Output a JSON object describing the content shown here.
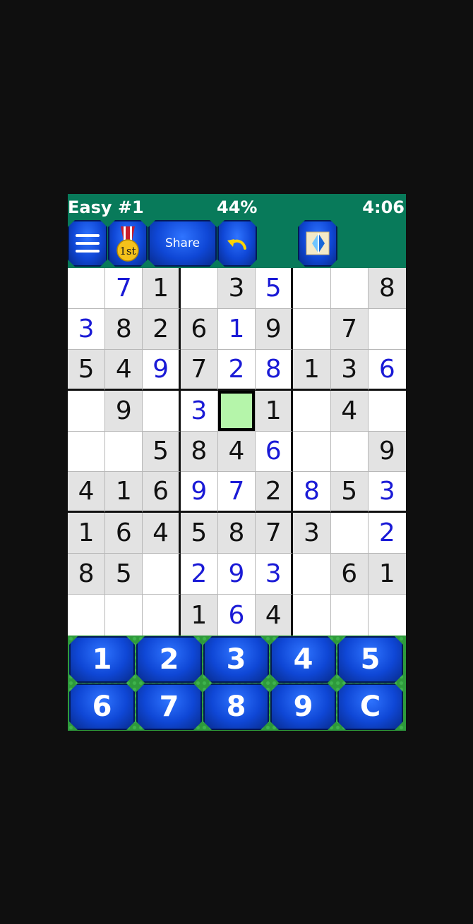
{
  "header": {
    "title": "Easy #1",
    "progress": "44%",
    "timer": "4:06"
  },
  "toolbar": {
    "menu_icon": "hamburger-menu-icon",
    "medal_icon": "first-place-medal-icon",
    "medal_label": "1st",
    "share_label": "Share",
    "undo_icon": "undo-arrow-icon",
    "hint_icon": "hint-panel-icon"
  },
  "board": {
    "selected": [
      3,
      4
    ],
    "rows": [
      [
        "",
        "7",
        "1",
        "",
        "3",
        "5",
        "",
        "",
        "8"
      ],
      [
        "3",
        "8",
        "2",
        "6",
        "1",
        "9",
        "",
        "7",
        ""
      ],
      [
        "5",
        "4",
        "9",
        "7",
        "2",
        "8",
        "1",
        "3",
        "6"
      ],
      [
        "",
        "9",
        "",
        "3",
        "",
        "1",
        "",
        "4",
        ""
      ],
      [
        "",
        "",
        "5",
        "8",
        "4",
        "6",
        "",
        "",
        "9"
      ],
      [
        "4",
        "1",
        "6",
        "9",
        "7",
        "2",
        "8",
        "5",
        "3"
      ],
      [
        "1",
        "6",
        "4",
        "5",
        "8",
        "7",
        "3",
        "",
        "2"
      ],
      [
        "8",
        "5",
        "",
        "2",
        "9",
        "3",
        "",
        "6",
        "1"
      ],
      [
        "",
        "",
        "",
        "1",
        "6",
        "4",
        "",
        "",
        ""
      ]
    ],
    "givens": [
      [
        0,
        0,
        1,
        0,
        1,
        0,
        0,
        0,
        1
      ],
      [
        0,
        1,
        1,
        1,
        0,
        1,
        0,
        1,
        0
      ],
      [
        1,
        1,
        0,
        1,
        0,
        0,
        1,
        1,
        0
      ],
      [
        0,
        1,
        0,
        0,
        0,
        1,
        0,
        1,
        0
      ],
      [
        0,
        0,
        1,
        1,
        1,
        0,
        0,
        0,
        1
      ],
      [
        1,
        1,
        1,
        0,
        0,
        1,
        0,
        1,
        0
      ],
      [
        1,
        1,
        1,
        1,
        1,
        1,
        1,
        0,
        0
      ],
      [
        1,
        1,
        0,
        0,
        0,
        0,
        0,
        1,
        1
      ],
      [
        0,
        0,
        0,
        1,
        0,
        1,
        0,
        0,
        0
      ]
    ],
    "colors": {
      "given_text": "#111111",
      "user_text": "#1a1ad6",
      "selected_bg": "#b5f5aa"
    }
  },
  "keypad": {
    "keys": [
      "1",
      "2",
      "3",
      "4",
      "5",
      "6",
      "7",
      "8",
      "9",
      "C"
    ]
  }
}
